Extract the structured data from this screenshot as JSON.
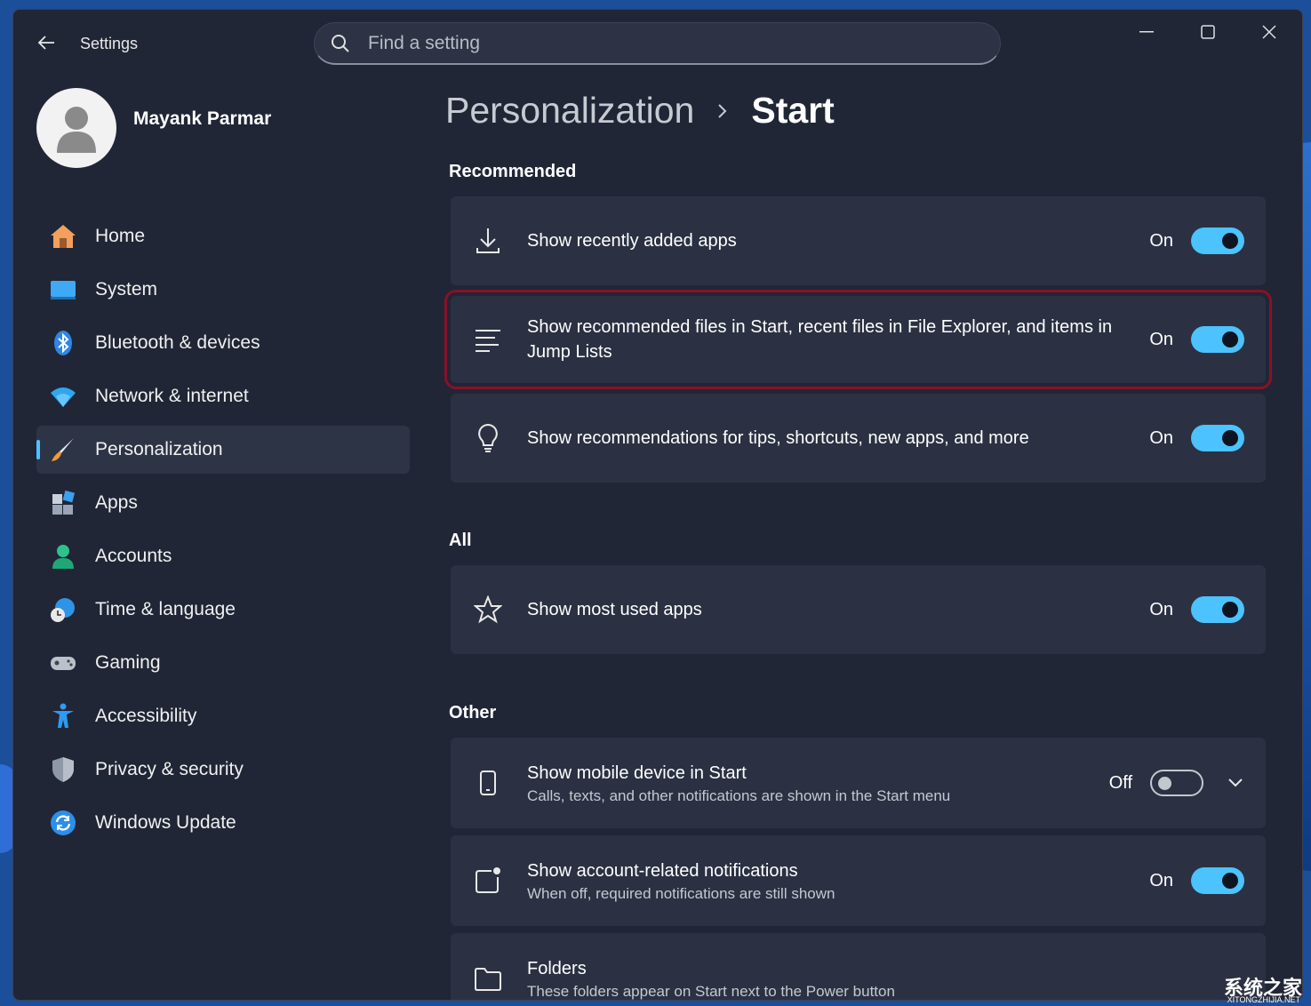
{
  "window": {
    "title": "Settings"
  },
  "search": {
    "placeholder": "Find a setting"
  },
  "user": {
    "name": "Mayank Parmar"
  },
  "nav": [
    {
      "label": "Home",
      "icon": "home-icon"
    },
    {
      "label": "System",
      "icon": "system-icon"
    },
    {
      "label": "Bluetooth & devices",
      "icon": "bluetooth-icon"
    },
    {
      "label": "Network & internet",
      "icon": "wifi-icon"
    },
    {
      "label": "Personalization",
      "icon": "brush-icon",
      "active": true
    },
    {
      "label": "Apps",
      "icon": "apps-icon"
    },
    {
      "label": "Accounts",
      "icon": "accounts-icon"
    },
    {
      "label": "Time & language",
      "icon": "globe-clock-icon"
    },
    {
      "label": "Gaming",
      "icon": "controller-icon"
    },
    {
      "label": "Accessibility",
      "icon": "accessibility-icon"
    },
    {
      "label": "Privacy & security",
      "icon": "shield-icon"
    },
    {
      "label": "Windows Update",
      "icon": "update-icon"
    }
  ],
  "breadcrumb": {
    "parent": "Personalization",
    "current": "Start"
  },
  "sections": {
    "recommended": "Recommended",
    "all": "All",
    "other": "Other"
  },
  "settings": {
    "recently_added": {
      "title": "Show recently added apps",
      "state": "On"
    },
    "recommended_files": {
      "title": "Show recommended files in Start, recent files in File Explorer, and items in Jump Lists",
      "state": "On"
    },
    "tips": {
      "title": "Show recommendations for tips, shortcuts, new apps, and more",
      "state": "On"
    },
    "most_used": {
      "title": "Show most used apps",
      "state": "On"
    },
    "mobile_device": {
      "title": "Show mobile device in Start",
      "subtitle": "Calls, texts, and other notifications are shown in the Start menu",
      "state": "Off"
    },
    "account_notifications": {
      "title": "Show account-related notifications",
      "subtitle": "When off, required notifications are still shown",
      "state": "On"
    },
    "folders": {
      "title": "Folders",
      "subtitle": "These folders appear on Start next to the Power button"
    }
  },
  "watermark": {
    "text": "系统之家",
    "sub": "XITONGZHIJIA.NET"
  },
  "colors": {
    "accent": "#4cc2ff",
    "highlight_border": "#8b1025",
    "window_bg": "#202636",
    "card_bg": "#2b3142"
  }
}
